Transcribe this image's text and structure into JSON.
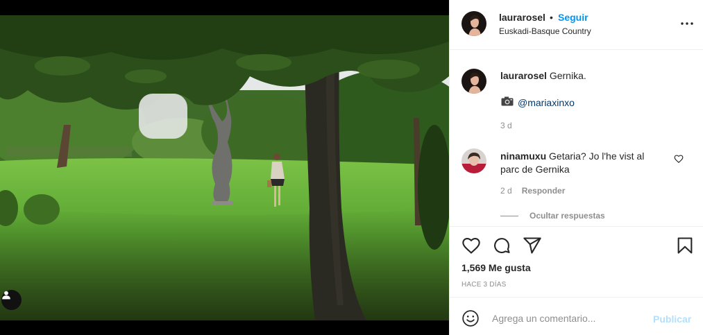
{
  "post": {
    "username": "laurarosel",
    "separator": "•",
    "follow_label": "Seguir",
    "location": "Euskadi-Basque Country",
    "more_icon": "more-options-icon",
    "image": {
      "description_icon": "tagged-user-icon"
    }
  },
  "caption": {
    "username": "laurarosel",
    "text": "Gernika.",
    "mention_icon": "camera-icon",
    "mention": "@mariaxinxo",
    "time": "3 d"
  },
  "comments": [
    {
      "username": "ninamuxu",
      "text": "Getaria? Jo l'he vist al parc de Gernika",
      "time": "2 d",
      "reply_label": "Responder",
      "hide_replies_label": "Ocultar respuestas"
    }
  ],
  "actions": {
    "like_icon": "heart-icon",
    "comment_icon": "comment-icon",
    "share_icon": "share-icon",
    "save_icon": "bookmark-icon",
    "likes": "1,569 Me gusta",
    "posted": "HACE 3 DÍAS"
  },
  "composer": {
    "placeholder": "Agrega un comentario...",
    "publish_label": "Publicar",
    "emoji_icon": "emoji-icon"
  },
  "colors": {
    "link_blue": "#0095f6",
    "publish_disabled": "#b2dffc",
    "muted": "#8e8e8e",
    "mention": "#00376b"
  }
}
